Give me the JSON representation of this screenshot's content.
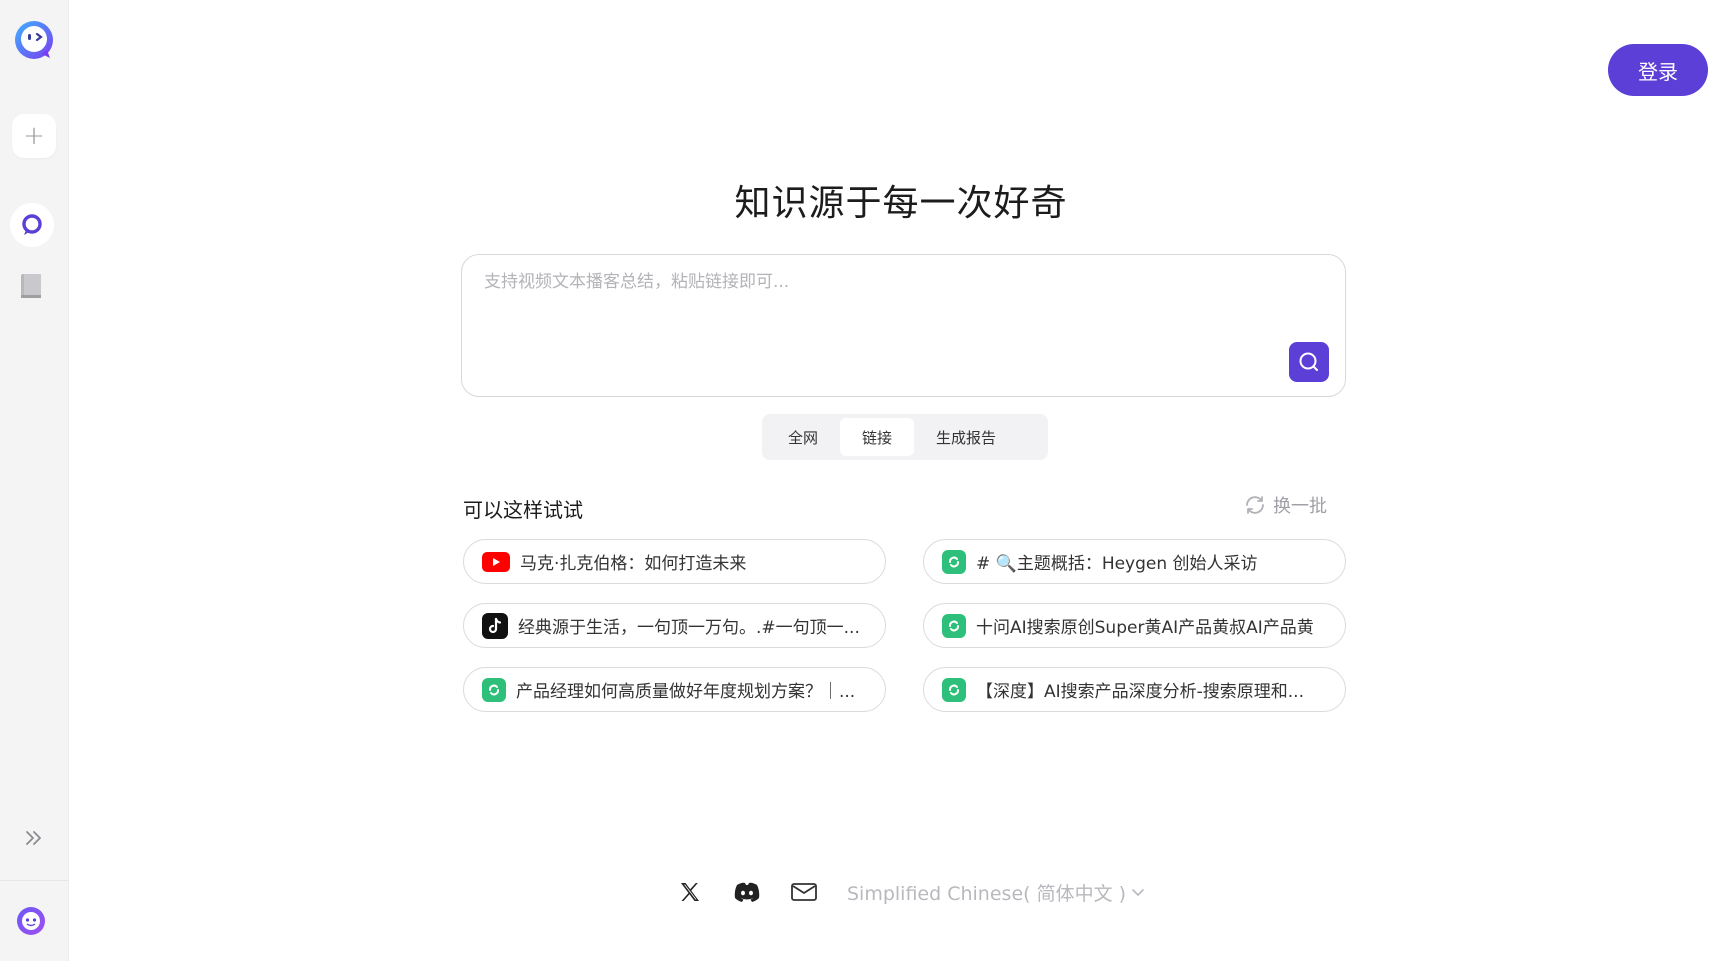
{
  "auth": {
    "login_label": "登录"
  },
  "hero": {
    "title": "知识源于每一次好奇"
  },
  "search": {
    "placeholder": "支持视频文本播客总结，粘贴链接即可...",
    "value": ""
  },
  "mode_tabs": [
    {
      "label": "全网",
      "active": false
    },
    {
      "label": "链接",
      "active": true
    },
    {
      "label": "生成报告",
      "active": false
    }
  ],
  "suggestions": {
    "title": "可以这样试试",
    "refresh_label": "换一批",
    "items": [
      {
        "icon": "youtube-icon",
        "text": "马克·扎克伯格：如何打造未来"
      },
      {
        "icon": "wechat-icon",
        "text": "# 🔍主题概括：Heygen 创始人采访"
      },
      {
        "icon": "tiktok-icon",
        "text": "经典源于生活，一句顶一万句。.#一句顶一..."
      },
      {
        "icon": "wechat-icon",
        "text": "十问AI搜索原创Super黄AI产品黄叔AI产品黄"
      },
      {
        "icon": "wechat-icon",
        "text": "产品经理如何高质量做好年度规划方案？｜..."
      },
      {
        "icon": "wechat-icon",
        "text": "【深度】AI搜索产品深度分析-搜索原理和..."
      }
    ]
  },
  "footer": {
    "language": "Simplified Chinese( 简体中文 )",
    "icons": [
      "x-icon",
      "discord-icon",
      "mail-icon"
    ]
  },
  "colors": {
    "accent": "#5b3fd6",
    "sidebar_bg": "#f4f4f5",
    "wechat_green": "#2ec07a",
    "youtube_red": "#ff0000"
  }
}
